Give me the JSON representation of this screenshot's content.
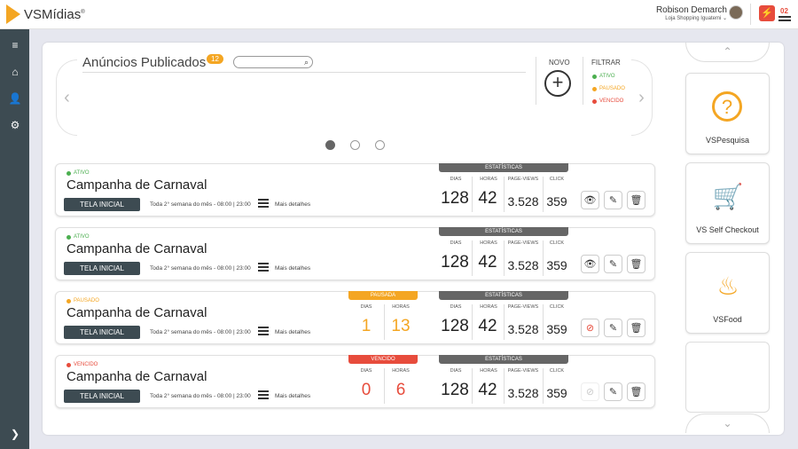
{
  "app": {
    "brand": "VSMídias",
    "brand_mark": "®",
    "accent": "#f4a623"
  },
  "user": {
    "name": "Robison Demarch",
    "store": "Loja Shopping Iguatemi ⌄"
  },
  "alerts": {
    "count": "02"
  },
  "sidebar": {
    "items": [
      {
        "name": "menu-icon",
        "glyph": "≡"
      },
      {
        "name": "home-icon",
        "glyph": "⌂"
      },
      {
        "name": "user-icon",
        "glyph": "👤"
      },
      {
        "name": "gear-icon",
        "glyph": "⚙"
      }
    ],
    "expand": "❯"
  },
  "header": {
    "title": "Anúncios Publicados",
    "count": "12",
    "search_placeholder": "",
    "novo_label": "NOVO",
    "novo_glyph": "+",
    "filter_label": "FILTRAR",
    "filters": [
      {
        "label": "ATIVO",
        "color": "#4caf50"
      },
      {
        "label": "PAUSADO",
        "color": "#f4a623"
      },
      {
        "label": "VENCIDO",
        "color": "#e74c3c"
      }
    ]
  },
  "stats_header": "ESTATÍSTICAS",
  "stats_labels": {
    "dias": "DIAS",
    "horas": "HORAS",
    "page_views": "PAGE-VIEWS",
    "click": "CLICK"
  },
  "ads": [
    {
      "status": "ATIVO",
      "status_color": "#4caf50",
      "title": "Campanha de Carnaval",
      "screen": "TELA INICIAL",
      "schedule": "Toda 2° semana do mês - 08:00 | 23:00",
      "details": "Mais detalhes",
      "stats": {
        "dias": "128",
        "horas": "42",
        "page_views": "3.528",
        "click": "359"
      }
    },
    {
      "status": "ATIVO",
      "status_color": "#4caf50",
      "title": "Campanha de Carnaval",
      "screen": "TELA INICIAL",
      "schedule": "Toda 2° semana do mês - 08:00 | 23:00",
      "details": "Mais detalhes",
      "stats": {
        "dias": "128",
        "horas": "42",
        "page_views": "3.528",
        "click": "359"
      }
    },
    {
      "status": "PAUSADO",
      "status_color": "#f4a623",
      "title": "Campanha de Carnaval",
      "screen": "TELA INICIAL",
      "schedule": "Toda 2° semana do mês - 08:00 | 23:00",
      "details": "Mais detalhes",
      "stats": {
        "dias": "128",
        "horas": "42",
        "page_views": "3.528",
        "click": "359"
      },
      "paused": {
        "label": "PAUSADA",
        "dias": "1",
        "horas": "13",
        "color": "#f4a623"
      }
    },
    {
      "status": "VENCIDO",
      "status_color": "#e74c3c",
      "title": "Campanha de Carnaval",
      "screen": "TELA INICIAL",
      "schedule": "Toda 2° semana do mês - 08:00 | 23:00",
      "details": "Mais detalhes",
      "stats": {
        "dias": "128",
        "horas": "42",
        "page_views": "3.528",
        "click": "359"
      },
      "paused": {
        "label": "VENCIDO",
        "dias": "0",
        "horas": "6",
        "color": "#e74c3c"
      }
    }
  ],
  "right_panel": [
    {
      "label": "VSPesquisa",
      "icon": "question-bubble-icon",
      "glyph": "?"
    },
    {
      "label": "VS Self Checkout",
      "icon": "shopping-cart-icon",
      "glyph": "🛒"
    },
    {
      "label": "VSFood",
      "icon": "chef-hat-icon",
      "glyph": "♨"
    }
  ]
}
